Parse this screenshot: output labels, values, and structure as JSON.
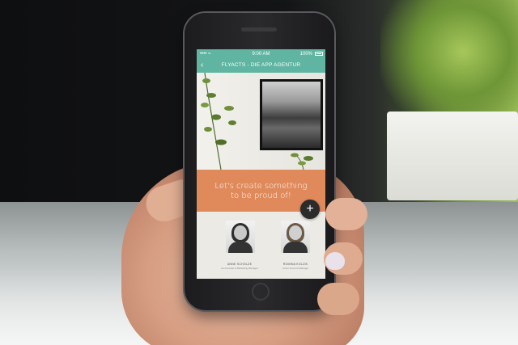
{
  "status_bar": {
    "signal": "•••• ≈",
    "time": "9:00 AM",
    "battery": "100%"
  },
  "nav": {
    "back_icon": "chevron-left-icon",
    "title": "FLYACTS - DIE APP AGENTUR"
  },
  "hero": {
    "tagline_line1": "Let's create something",
    "tagline_line2": "to be proud of!"
  },
  "fab": {
    "icon": "plus-icon",
    "label": "+"
  },
  "team": [
    {
      "name": "ANNE SCHOLZE",
      "role": "Co-Founder & Marketing Manager"
    },
    {
      "name": "ROMINA KOLZIK",
      "role": "Junior Account Manager"
    }
  ],
  "colors": {
    "nav_teal": "#5fb5a1",
    "banner_orange": "#e08a5c",
    "fab_dark": "#2b2b2b"
  }
}
